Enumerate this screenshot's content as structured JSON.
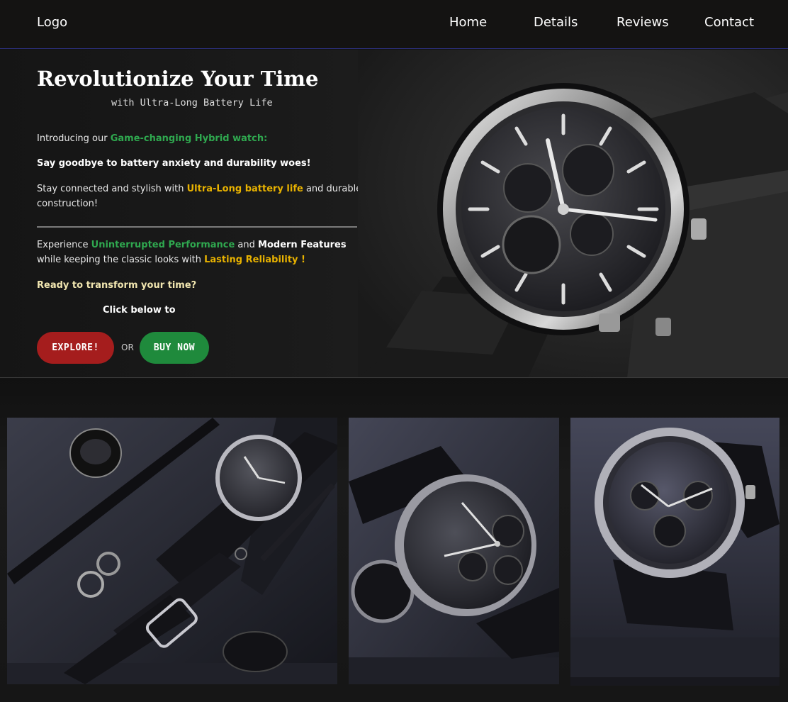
{
  "nav": {
    "logo": "Logo",
    "links": [
      "Home",
      "Details",
      "Reviews",
      "Contact"
    ]
  },
  "hero": {
    "title": "Revolutionize Your Time",
    "subtitle": "with Ultra-Long Battery Life",
    "p1_prefix": "Introducing our ",
    "p1_highlight": "Game-changing Hybrid watch:",
    "p2": "Say goodbye to battery anxiety and durability woes!",
    "p3_prefix": "Stay connected and stylish with ",
    "p3_highlight": "Ultra-Long battery life",
    "p3_suffix": " and durable construction!",
    "p4_prefix": "Experience ",
    "p4_green": "Uninterrupted Performance",
    "p4_mid": " and ",
    "p4_bold": "Modern Features",
    "p4_mid2": " while keeping the classic looks with ",
    "p4_gold": "Lasting Reliability !",
    "p5": "Ready to transform your time?",
    "p6": "Click below to",
    "explore_label": "EXPLORE!",
    "or_label": "OR",
    "buy_label": "BUY NOW"
  },
  "colors": {
    "accent_green": "#2fa84f",
    "accent_gold": "#e8b200",
    "explore_red": "#a51d1d",
    "buy_green": "#1f8a3c"
  },
  "gallery": {
    "images": [
      "watch-flatlay-image",
      "watch-angle-image",
      "watch-front-image"
    ]
  }
}
